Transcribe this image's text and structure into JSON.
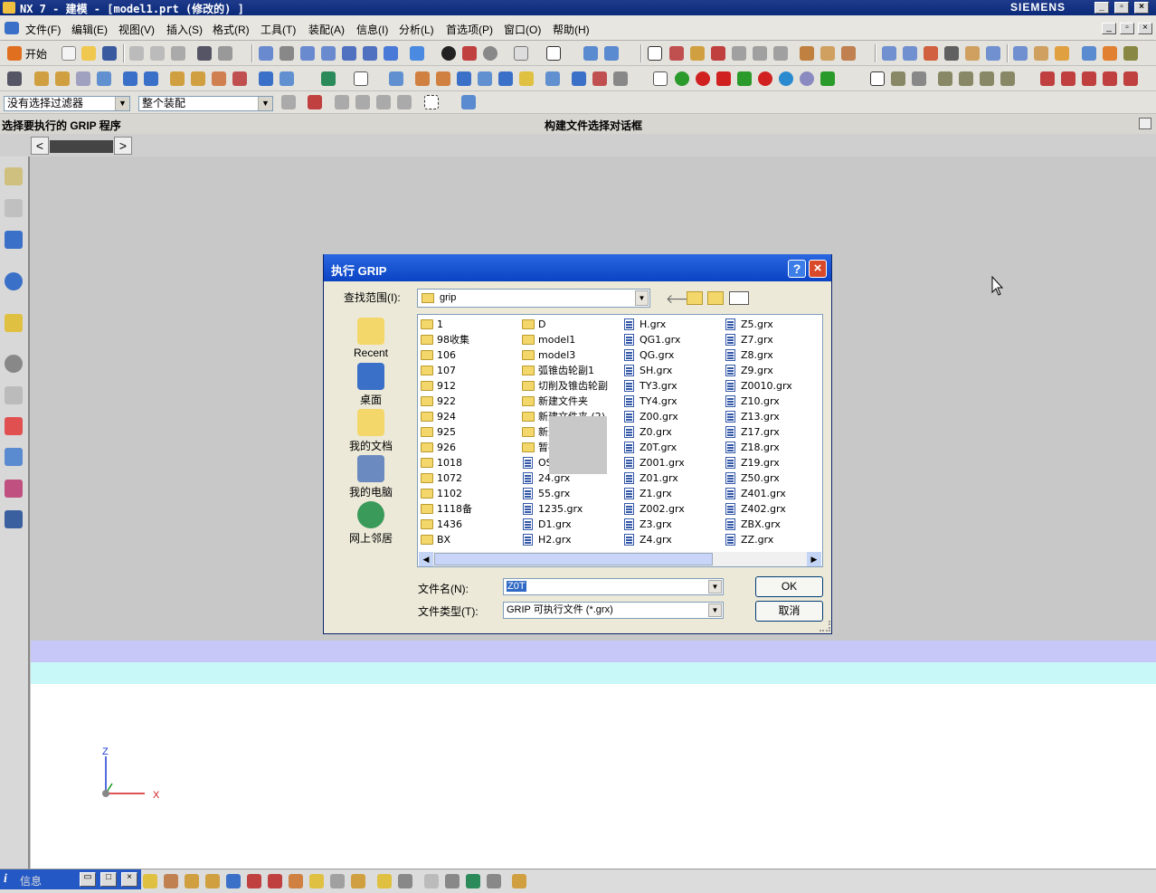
{
  "window": {
    "title": "NX 7 - 建模 - [model1.prt (修改的) ]",
    "brand": "SIEMENS"
  },
  "menu": {
    "file": "文件(F)",
    "edit": "编辑(E)",
    "view": "视图(V)",
    "insert": "插入(S)",
    "format": "格式(R)",
    "tools": "工具(T)",
    "assembly": "装配(A)",
    "info": "信息(I)",
    "analysis": "分析(L)",
    "preferences": "首选项(P)",
    "window": "窗口(O)",
    "help": "帮助(H)"
  },
  "toolbar": {
    "start_label": "开始"
  },
  "selection_bar": {
    "filter": "没有选择过滤器",
    "scope": "整个装配"
  },
  "cue_line": {
    "left": "选择要执行的 GRIP 程序",
    "right": "构建文件选择对话框"
  },
  "dialog": {
    "title": "执行 GRIP",
    "look_in_label": "查找范围(I):",
    "look_in_value": "grip",
    "places": [
      "Recent",
      "桌面",
      "我的文档",
      "我的电脑",
      "网上邻居"
    ],
    "columns": [
      [
        {
          "name": "1",
          "type": "folder"
        },
        {
          "name": "98收集",
          "type": "folder"
        },
        {
          "name": "106",
          "type": "folder"
        },
        {
          "name": "107",
          "type": "folder"
        },
        {
          "name": "912",
          "type": "folder"
        },
        {
          "name": "922",
          "type": "folder"
        },
        {
          "name": "924",
          "type": "folder"
        },
        {
          "name": "925",
          "type": "folder"
        },
        {
          "name": "926",
          "type": "folder"
        },
        {
          "name": "1018",
          "type": "folder"
        },
        {
          "name": "1072",
          "type": "folder"
        },
        {
          "name": "1102",
          "type": "folder"
        },
        {
          "name": "1118备",
          "type": "folder"
        },
        {
          "name": "1436",
          "type": "folder"
        },
        {
          "name": "BX",
          "type": "folder"
        }
      ],
      [
        {
          "name": "D",
          "type": "folder"
        },
        {
          "name": "model1",
          "type": "folder"
        },
        {
          "name": "model3",
          "type": "folder"
        },
        {
          "name": "弧锥齿轮副1",
          "type": "folder"
        },
        {
          "name": "切削及锥齿轮副",
          "type": "folder"
        },
        {
          "name": "新建文件夹",
          "type": "folder"
        },
        {
          "name": "新建文件夹 (2)",
          "type": "folder"
        },
        {
          "name": "新建文件夹 (3)",
          "type": "folder"
        },
        {
          "name": "暂存",
          "type": "folder"
        },
        {
          "name": "OSN.grx",
          "type": "grx"
        },
        {
          "name": "24.grx",
          "type": "grx"
        },
        {
          "name": "55.grx",
          "type": "grx"
        },
        {
          "name": "1235.grx",
          "type": "grx"
        },
        {
          "name": "D1.grx",
          "type": "grx"
        },
        {
          "name": "H2.grx",
          "type": "grx"
        }
      ],
      [
        {
          "name": "H.grx",
          "type": "grx"
        },
        {
          "name": "QG1.grx",
          "type": "grx"
        },
        {
          "name": "QG.grx",
          "type": "grx"
        },
        {
          "name": "SH.grx",
          "type": "grx"
        },
        {
          "name": "TY3.grx",
          "type": "grx"
        },
        {
          "name": "TY4.grx",
          "type": "grx"
        },
        {
          "name": "Z00.grx",
          "type": "grx"
        },
        {
          "name": "Z0.grx",
          "type": "grx"
        },
        {
          "name": "Z0T.grx",
          "type": "grx"
        },
        {
          "name": "Z001.grx",
          "type": "grx"
        },
        {
          "name": "Z01.grx",
          "type": "grx"
        },
        {
          "name": "Z1.grx",
          "type": "grx"
        },
        {
          "name": "Z002.grx",
          "type": "grx"
        },
        {
          "name": "Z3.grx",
          "type": "grx"
        },
        {
          "name": "Z4.grx",
          "type": "grx"
        }
      ],
      [
        {
          "name": "Z5.grx",
          "type": "grx"
        },
        {
          "name": "Z7.grx",
          "type": "grx"
        },
        {
          "name": "Z8.grx",
          "type": "grx"
        },
        {
          "name": "Z9.grx",
          "type": "grx"
        },
        {
          "name": "Z0010.grx",
          "type": "grx"
        },
        {
          "name": "Z10.grx",
          "type": "grx"
        },
        {
          "name": "Z13.grx",
          "type": "grx"
        },
        {
          "name": "Z17.grx",
          "type": "grx"
        },
        {
          "name": "Z18.grx",
          "type": "grx"
        },
        {
          "name": "Z19.grx",
          "type": "grx"
        },
        {
          "name": "Z50.grx",
          "type": "grx"
        },
        {
          "name": "Z401.grx",
          "type": "grx"
        },
        {
          "name": "Z402.grx",
          "type": "grx"
        },
        {
          "name": "ZBX.grx",
          "type": "grx"
        },
        {
          "name": "ZZ.grx",
          "type": "grx"
        }
      ]
    ],
    "filename_label": "文件名(N):",
    "filename_value": "Z0T",
    "filetype_label": "文件类型(T):",
    "filetype_value": "GRIP 可执行文件 (*.grx)",
    "ok_label": "OK",
    "cancel_label": "取消"
  },
  "triad": {
    "z": "Z",
    "x": "X"
  },
  "info_window": {
    "label": "信息"
  },
  "colors": {
    "titlebar": "#0b2a7a",
    "band_lavender": "#c8c8f8",
    "band_cyan": "#c8f8f8",
    "dialog_title": "#0a43c4"
  }
}
